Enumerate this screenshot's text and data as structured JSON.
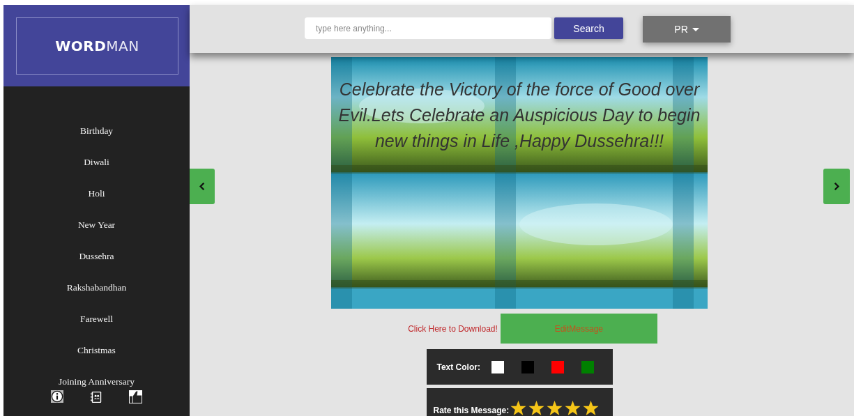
{
  "logo": {
    "bold": "WORD",
    "light": "MAN"
  },
  "sidebar": {
    "items": [
      {
        "label": "Birthday"
      },
      {
        "label": "Diwali"
      },
      {
        "label": "Holi"
      },
      {
        "label": "New Year"
      },
      {
        "label": "Dussehra"
      },
      {
        "label": "Rakshabandhan"
      },
      {
        "label": "Farewell"
      },
      {
        "label": "Christmas"
      },
      {
        "label": "Joining Anniversary"
      }
    ]
  },
  "search": {
    "placeholder": "type here anything...",
    "button": "Search"
  },
  "user_menu": {
    "label": "PR"
  },
  "card": {
    "message": "Celebrate the Victory of the force of Good over Evil.Lets Celebrate an Auspicious Day to begin new things in Life ,Happy Dussehra!!!"
  },
  "actions": {
    "download": "Click Here to Download!",
    "edit": "EditMessage"
  },
  "text_color": {
    "label": "Text Color:",
    "swatches": [
      {
        "color": "#ffffff"
      },
      {
        "color": "#000000"
      },
      {
        "color": "#ff0000"
      },
      {
        "color": "#008000"
      }
    ]
  },
  "rating": {
    "label": "Rate this Message:",
    "stars": 5
  }
}
